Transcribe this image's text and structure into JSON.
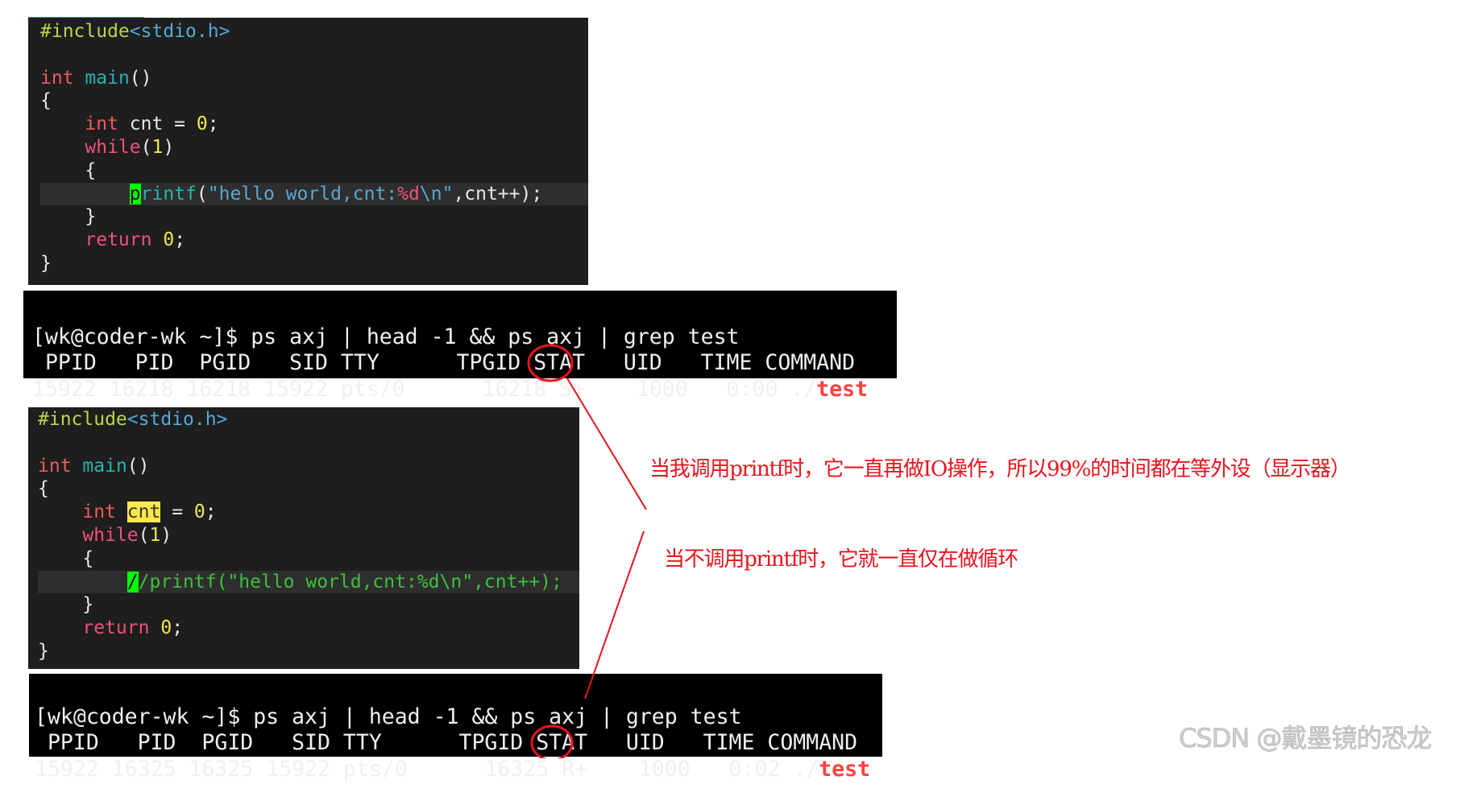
{
  "colors": {
    "accent_red": "#e8141e",
    "code_bg": "#1e1e1e",
    "terminal_bg": "#000000",
    "cursor": "#00ff00"
  },
  "code_before": {
    "lines": [
      [
        [
          "#include",
          "pre"
        ],
        [
          "<stdio.h>",
          "inc"
        ]
      ],
      [],
      [
        [
          "int",
          "kw"
        ],
        [
          " ",
          "txt"
        ],
        [
          "main",
          "fn"
        ],
        [
          "()",
          "txt"
        ]
      ],
      [
        [
          "{",
          "txt"
        ]
      ],
      [
        [
          "    ",
          "txt"
        ],
        [
          "int",
          "kw"
        ],
        [
          " cnt = ",
          "txt"
        ],
        [
          "0",
          "num"
        ],
        [
          ";",
          "txt"
        ]
      ],
      [
        [
          "    ",
          "txt"
        ],
        [
          "while",
          "ctl"
        ],
        [
          "(",
          "txt"
        ],
        [
          "1",
          "num"
        ],
        [
          ")",
          "txt"
        ]
      ],
      [
        [
          "    {",
          "txt"
        ]
      ],
      [
        [
          "        ",
          "txt"
        ],
        [
          "p",
          "cursor"
        ],
        [
          "rintf",
          "call"
        ],
        [
          "(",
          "txt"
        ],
        [
          "\"hello world,cnt:",
          "str"
        ],
        [
          "%d",
          "esc"
        ],
        [
          "\\n",
          "str"
        ],
        [
          "\"",
          "str"
        ],
        [
          ",cnt++);",
          "txt"
        ]
      ],
      [
        [
          "    }",
          "txt"
        ]
      ],
      [
        [
          "    ",
          "txt"
        ],
        [
          "return",
          "ctl"
        ],
        [
          " ",
          "txt"
        ],
        [
          "0",
          "num"
        ],
        [
          ";",
          "txt"
        ]
      ],
      [
        [
          "}",
          "txt"
        ]
      ]
    ],
    "current_line": 7
  },
  "terminal_before": {
    "command": "[wk@coder-wk ~]$ ps axj | head -1 && ps axj | grep test",
    "header": " PPID   PID  PGID   SID TTY      TPGID STAT   UID   TIME COMMAND",
    "row_prefix": "15922 16218 16218 15922 pts/0      16218 ",
    "stat": "S+",
    "row_middle": "    1000   0:00 ./",
    "process": "test"
  },
  "code_after": {
    "lines": [
      [
        [
          "#include",
          "pre"
        ],
        [
          "<stdio.h>",
          "inc"
        ]
      ],
      [],
      [
        [
          "int",
          "kw"
        ],
        [
          " ",
          "txt"
        ],
        [
          "main",
          "fn"
        ],
        [
          "()",
          "txt"
        ]
      ],
      [
        [
          "{",
          "txt"
        ]
      ],
      [
        [
          "    ",
          "txt"
        ],
        [
          "int",
          "kw"
        ],
        [
          " ",
          "txt"
        ],
        [
          "cnt",
          "hl"
        ],
        [
          " = ",
          "txt"
        ],
        [
          "0",
          "num"
        ],
        [
          ";",
          "txt"
        ]
      ],
      [
        [
          "    ",
          "txt"
        ],
        [
          "while",
          "ctl"
        ],
        [
          "(",
          "txt"
        ],
        [
          "1",
          "num"
        ],
        [
          ")",
          "txt"
        ]
      ],
      [
        [
          "    {",
          "txt"
        ]
      ],
      [
        [
          "        ",
          "txt"
        ],
        [
          "/",
          "cursor"
        ],
        [
          "/printf(\"hello world,cnt:%d\\n\",cnt++);",
          "cmt"
        ]
      ],
      [
        [
          "    }",
          "txt"
        ]
      ],
      [
        [
          "    ",
          "txt"
        ],
        [
          "return",
          "ctl"
        ],
        [
          " ",
          "txt"
        ],
        [
          "0",
          "num"
        ],
        [
          ";",
          "txt"
        ]
      ],
      [
        [
          "}",
          "txt"
        ]
      ]
    ],
    "current_line": 7
  },
  "terminal_after": {
    "command": "[wk@coder-wk ~]$ ps axj | head -1 && ps axj | grep test",
    "header": " PPID   PID  PGID   SID TTY      TPGID STAT   UID   TIME COMMAND",
    "row_prefix": "15922 16325 16325 15922 pts/0      16325 ",
    "stat": "R+",
    "row_middle": "    1000   0:02 ./",
    "process": "test"
  },
  "annotations": {
    "with_printf": "当我调用printf时，它一直再做IO操作，所以99%的时间都在等外设（显示器）",
    "without_printf": "当不调用printf时，它就一直仅在做循环"
  },
  "watermark": "CSDN @戴墨镜的恐龙"
}
